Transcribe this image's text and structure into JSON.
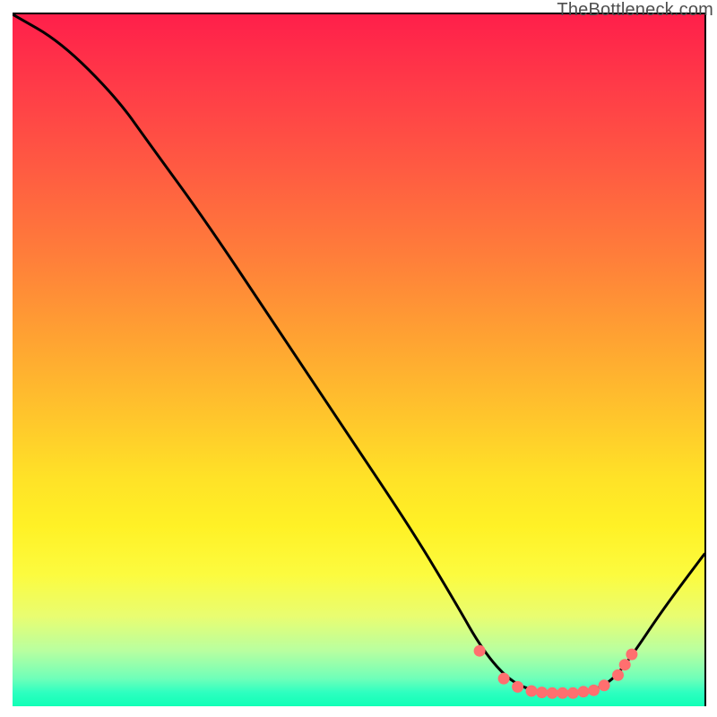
{
  "watermark": "TheBottleneck.com",
  "chart_data": {
    "type": "line",
    "title": "",
    "xlabel": "",
    "ylabel": "",
    "xlim": [
      0,
      100
    ],
    "ylim": [
      0,
      100
    ],
    "grid": false,
    "legend": false,
    "curve": [
      {
        "x": 0,
        "y": 100
      },
      {
        "x": 7,
        "y": 96
      },
      {
        "x": 15,
        "y": 88
      },
      {
        "x": 20,
        "y": 81
      },
      {
        "x": 28,
        "y": 70
      },
      {
        "x": 38,
        "y": 55
      },
      {
        "x": 48,
        "y": 40
      },
      {
        "x": 58,
        "y": 25
      },
      {
        "x": 64,
        "y": 15
      },
      {
        "x": 68,
        "y": 8
      },
      {
        "x": 72,
        "y": 3.5
      },
      {
        "x": 76,
        "y": 2
      },
      {
        "x": 80,
        "y": 1.8
      },
      {
        "x": 84,
        "y": 2.2
      },
      {
        "x": 87,
        "y": 4
      },
      {
        "x": 90,
        "y": 8
      },
      {
        "x": 94,
        "y": 14
      },
      {
        "x": 100,
        "y": 22
      }
    ],
    "markers": [
      {
        "x": 67.5,
        "y": 8.0
      },
      {
        "x": 71.0,
        "y": 4.0
      },
      {
        "x": 73.0,
        "y": 2.8
      },
      {
        "x": 75.0,
        "y": 2.2
      },
      {
        "x": 76.5,
        "y": 2.0
      },
      {
        "x": 78.0,
        "y": 1.9
      },
      {
        "x": 79.5,
        "y": 1.9
      },
      {
        "x": 81.0,
        "y": 1.9
      },
      {
        "x": 82.5,
        "y": 2.1
      },
      {
        "x": 84.0,
        "y": 2.3
      },
      {
        "x": 85.5,
        "y": 3.0
      },
      {
        "x": 87.5,
        "y": 4.5
      },
      {
        "x": 88.5,
        "y": 6.0
      },
      {
        "x": 89.5,
        "y": 7.5
      }
    ],
    "marker_color": "#ff6f6f",
    "line_color": "#000000"
  }
}
